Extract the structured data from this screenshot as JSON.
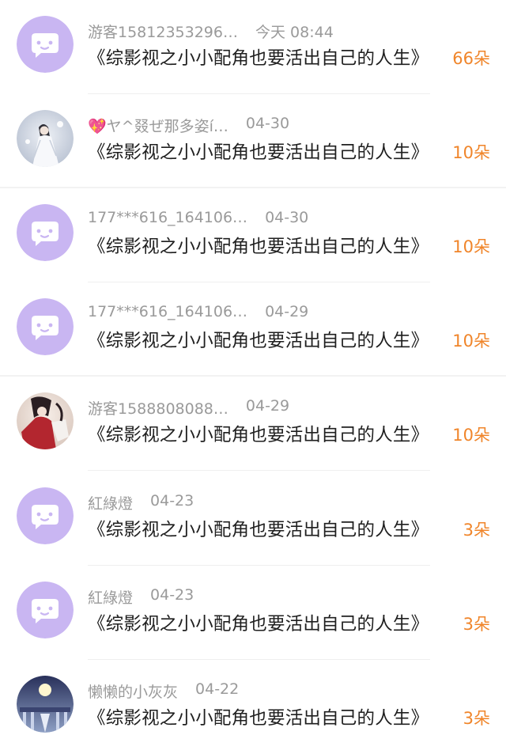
{
  "items": [
    {
      "avatar": "default-chat-avatar",
      "name": "游客15812353296…",
      "date": "今天 08:44",
      "title": "《综影视之小小配角也要活出自己的人生》",
      "count": "66朵"
    },
    {
      "avatar": "photo-avatar-white-robed-figure",
      "name": "💖ヤ^叕ぜ那多姿í…",
      "date": "04-30",
      "title": "《综影视之小小配角也要活出自己的人生》",
      "count": "10朵"
    },
    {
      "avatar": "default-chat-avatar",
      "name": "177***616_164106…",
      "date": "04-30",
      "title": "《综影视之小小配角也要活出自己的人生》",
      "count": "10朵"
    },
    {
      "avatar": "default-chat-avatar",
      "name": "177***616_164106…",
      "date": "04-29",
      "title": "《综影视之小小配角也要活出自己的人生》",
      "count": "10朵"
    },
    {
      "avatar": "photo-avatar-red-robed-figure",
      "name": "游客1588808088…",
      "date": "04-29",
      "title": "《综影视之小小配角也要活出自己的人生》",
      "count": "10朵"
    },
    {
      "avatar": "default-chat-avatar",
      "name": "紅綠燈",
      "date": "04-23",
      "title": "《综影视之小小配角也要活出自己的人生》",
      "count": "3朵"
    },
    {
      "avatar": "default-chat-avatar",
      "name": "紅綠燈",
      "date": "04-23",
      "title": "《综影视之小小配角也要活出自己的人生》",
      "count": "3朵"
    },
    {
      "avatar": "photo-avatar-night-scene",
      "name": "懒懒的小灰灰",
      "date": "04-22",
      "title": "《综影视之小小配角也要活出自己的人生》",
      "count": "3朵"
    }
  ],
  "colors": {
    "avatar_bg": "#c9b6f2",
    "count": "#f0852a",
    "meta": "#9a9a9a",
    "title": "#1f1f1f"
  }
}
